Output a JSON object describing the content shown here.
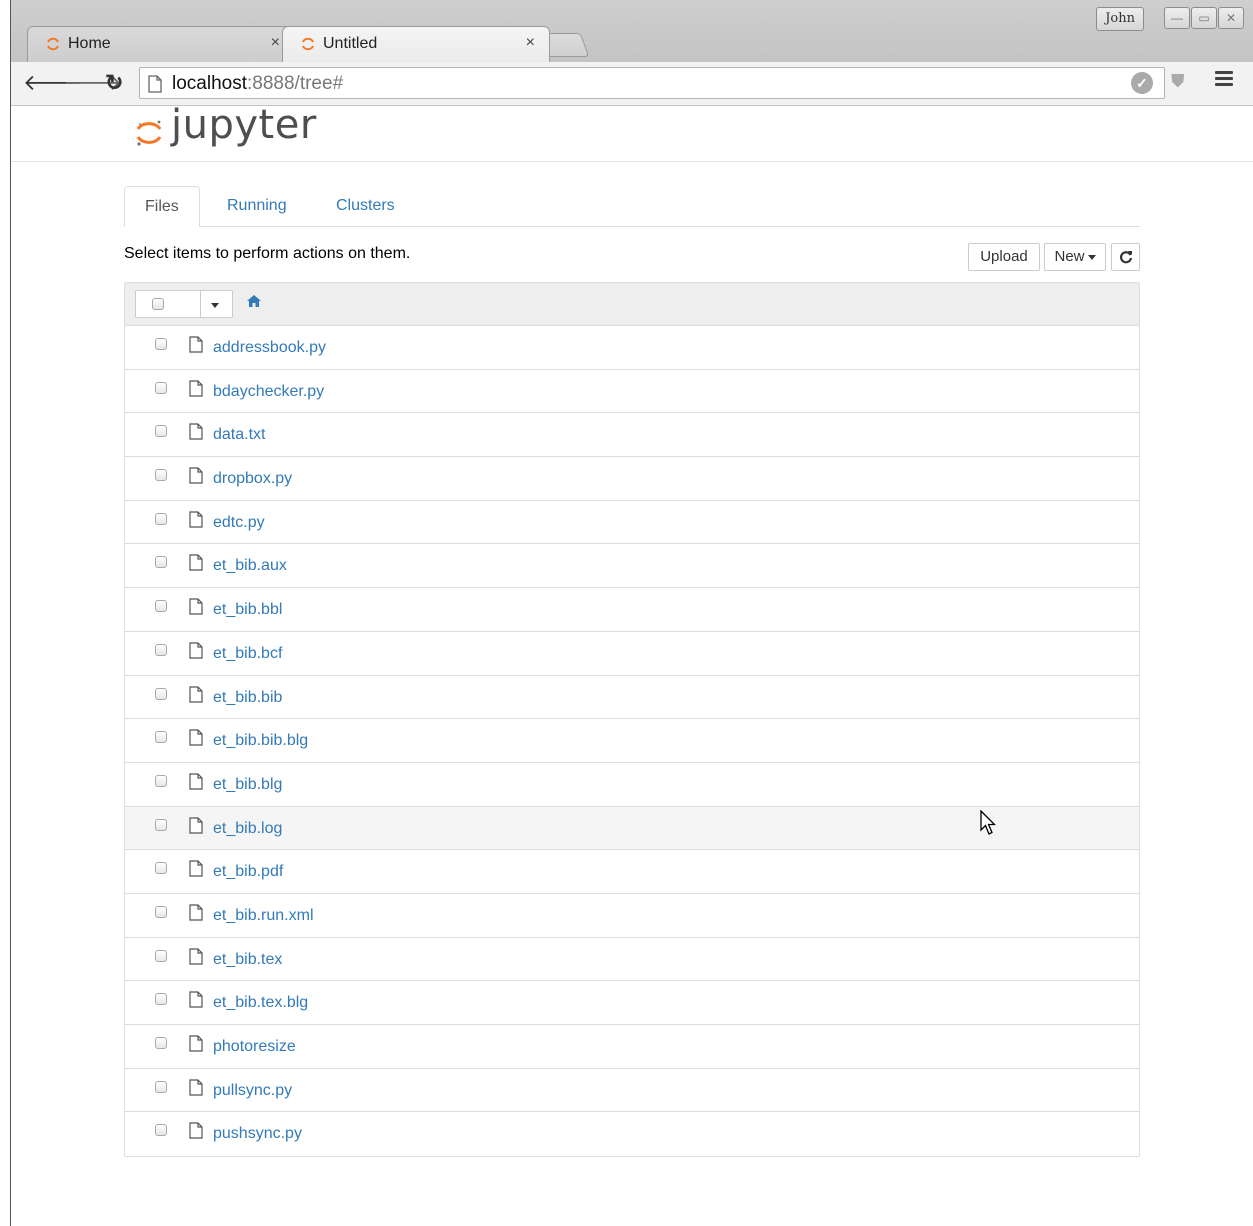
{
  "browser": {
    "tabs": [
      {
        "title": "Home",
        "close": "×"
      },
      {
        "title": "Untitled",
        "close": "×"
      }
    ],
    "user": "John",
    "url_host": "localhost",
    "url_rest": ":8888/tree#"
  },
  "app": {
    "logo_text": "jupyter",
    "tabs": [
      "Files",
      "Running",
      "Clusters"
    ],
    "hint": "Select items to perform actions on them.",
    "upload_label": "Upload",
    "new_label": "New"
  },
  "files": [
    "addressbook.py",
    "bdaychecker.py",
    "data.txt",
    "dropbox.py",
    "edtc.py",
    "et_bib.aux",
    "et_bib.bbl",
    "et_bib.bcf",
    "et_bib.bib",
    "et_bib.bib.blg",
    "et_bib.blg",
    "et_bib.log",
    "et_bib.pdf",
    "et_bib.run.xml",
    "et_bib.tex",
    "et_bib.tex.blg",
    "photoresize",
    "pullsync.py",
    "pushsync.py"
  ],
  "colors": {
    "link": "#337ab7",
    "jupyter_orange": "#f37726"
  }
}
